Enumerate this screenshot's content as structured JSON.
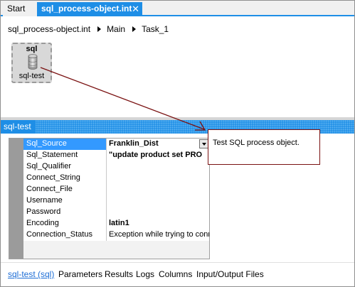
{
  "tabs": [
    {
      "label": "Start",
      "active": false
    },
    {
      "label": "sql_process-object.int",
      "active": true,
      "close": "✕"
    }
  ],
  "breadcrumb": [
    "sql_process-object.int",
    "Main",
    "Task_1"
  ],
  "canvas": {
    "node": {
      "type_label": "sql",
      "name": "sql-test",
      "icon": "database-icon"
    }
  },
  "panel": {
    "title": "sql-test",
    "description": "Test SQL process object."
  },
  "properties": [
    {
      "name": "Sql_Source",
      "value": "Franklin_Dist",
      "bold": true,
      "selected": true,
      "dropdown": true
    },
    {
      "name": "Sql_Statement",
      "value": "\"update product set PRO",
      "bold": true,
      "selected": false,
      "dropdown": false
    },
    {
      "name": "Sql_Qualifier",
      "value": "",
      "bold": false,
      "selected": false,
      "dropdown": false
    },
    {
      "name": "Connect_String",
      "value": "",
      "bold": false,
      "selected": false,
      "dropdown": false
    },
    {
      "name": "Connect_File",
      "value": "",
      "bold": false,
      "selected": false,
      "dropdown": false
    },
    {
      "name": "Username",
      "value": "",
      "bold": false,
      "selected": false,
      "dropdown": false
    },
    {
      "name": "Password",
      "value": "",
      "bold": false,
      "selected": false,
      "dropdown": false
    },
    {
      "name": "Encoding",
      "value": "latin1",
      "bold": true,
      "selected": false,
      "dropdown": false
    },
    {
      "name": "Connection_Status",
      "value": "Exception while trying to conn",
      "bold": false,
      "selected": false,
      "dropdown": false
    }
  ],
  "bottom_tabs": [
    {
      "label": "sql-test (sql)",
      "active": true
    },
    {
      "label": "Parameters",
      "active": false
    },
    {
      "label": "Results",
      "active": false
    },
    {
      "label": "Logs",
      "active": false
    },
    {
      "label": "Columns",
      "active": false
    },
    {
      "label": "Input/Output Files",
      "active": false
    }
  ],
  "colors": {
    "accent": "#1e8ee6",
    "selection": "#3399ff",
    "connector": "#7a1111",
    "link": "#1e6ed6"
  }
}
